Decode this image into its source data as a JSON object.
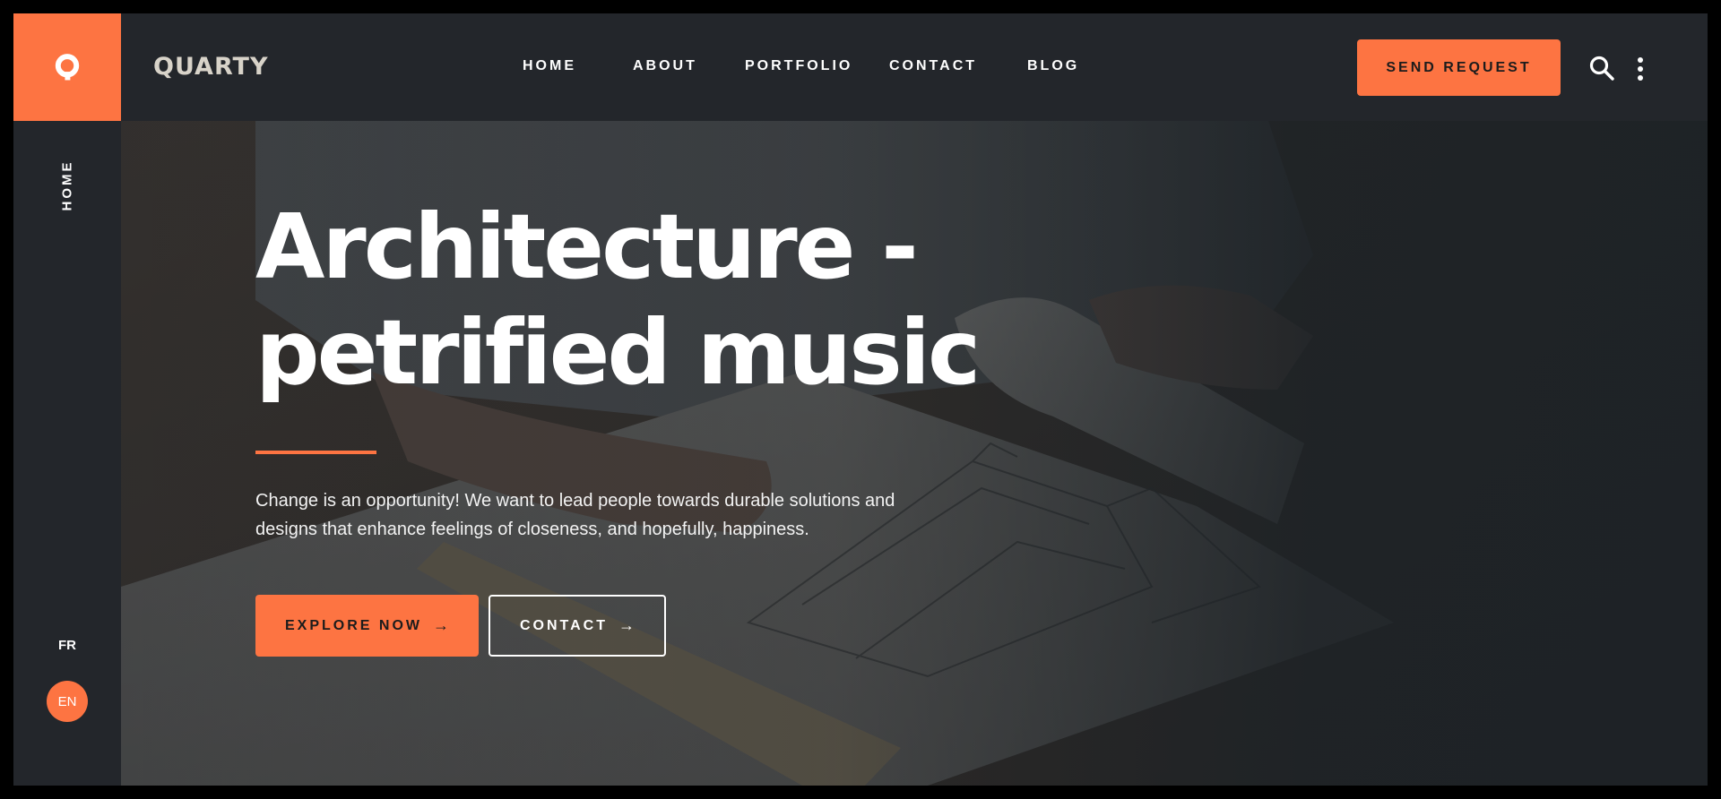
{
  "brand": {
    "logo_letter": "Q",
    "name": "QUARTY",
    "accent_color": "#fd7442",
    "background_color": "#23262b"
  },
  "nav": {
    "items": [
      {
        "label": "HOME"
      },
      {
        "label": "ABOUT"
      },
      {
        "label": "PORTFOLIO"
      },
      {
        "label": "CONTACT"
      },
      {
        "label": "BLOG"
      }
    ]
  },
  "header": {
    "cta_label": "SEND REQUEST",
    "search_icon": "search-icon",
    "menu_icon": "more-vertical-icon"
  },
  "sidebar": {
    "current_section": "HOME",
    "languages": [
      {
        "code": "FR",
        "active": false
      },
      {
        "code": "EN",
        "active": true
      }
    ]
  },
  "hero": {
    "title_line1": "Architecture -",
    "title_line2": "petrified music",
    "description": "Change is an opportunity! We want to lead people towards durable solutions and designs that enhance feelings of closeness, and hopefully, happiness.",
    "primary_button": {
      "label": "EXPLORE NOW",
      "icon": "arrow-right-icon"
    },
    "secondary_button": {
      "label": "CONTACT",
      "icon": "arrow-right-icon"
    }
  }
}
